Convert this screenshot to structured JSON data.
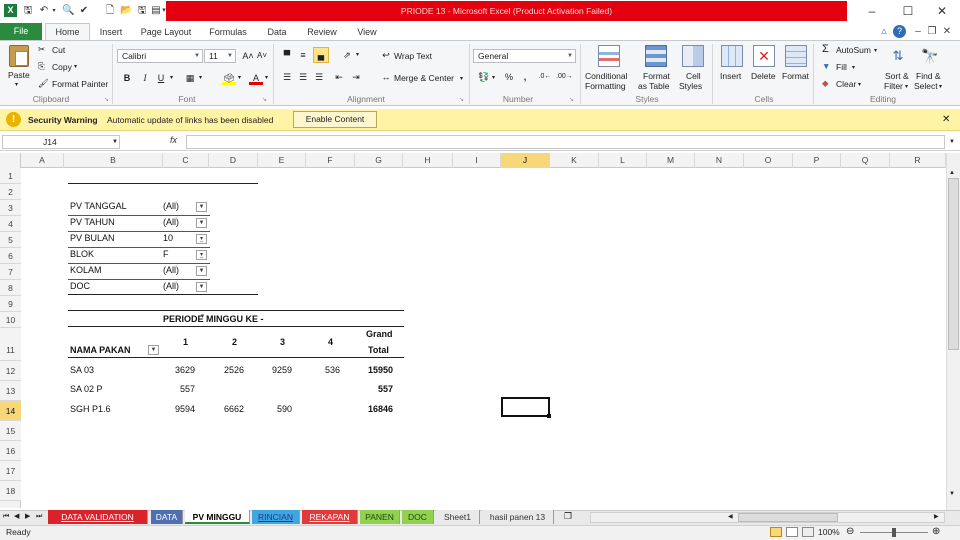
{
  "window": {
    "title": "PRIODE 13 -  Microsoft Excel (Product Activation Failed)"
  },
  "ribbon_tabs": [
    "File",
    "Home",
    "Insert",
    "Page Layout",
    "Formulas",
    "Data",
    "Review",
    "View"
  ],
  "ribbon": {
    "clipboard": {
      "paste": "Paste",
      "cut": "Cut",
      "copy": "Copy",
      "format_painter": "Format Painter",
      "group": "Clipboard"
    },
    "font": {
      "name": "Calibri",
      "size": "11",
      "bold": "B",
      "italic": "I",
      "underline": "U",
      "group": "Font"
    },
    "alignment": {
      "wrap_text": "Wrap Text",
      "merge_center": "Merge & Center",
      "group": "Alignment"
    },
    "number": {
      "format": "General",
      "percent": "%",
      "comma": ",",
      "group": "Number"
    },
    "styles": {
      "conditional": "Conditional",
      "conditional2": "Formatting",
      "format_as": "Format",
      "format_as2": "as Table",
      "cell_styles": "Cell",
      "cell_styles2": "Styles",
      "group": "Styles"
    },
    "cells": {
      "insert": "Insert",
      "delete": "Delete",
      "format": "Format",
      "group": "Cells"
    },
    "editing": {
      "autosum": "AutoSum",
      "fill": "Fill",
      "clear": "Clear",
      "sort": "Sort &",
      "sort2": "Filter",
      "find": "Find &",
      "find2": "Select",
      "group": "Editing"
    }
  },
  "security": {
    "label": "Security Warning",
    "message": "Automatic update of links has been disabled",
    "button": "Enable Content"
  },
  "formula_bar": {
    "name_box": "J14",
    "fx": "fx",
    "value": ""
  },
  "columns": [
    "A",
    "B",
    "C",
    "D",
    "E",
    "F",
    "G",
    "H",
    "I",
    "J",
    "K",
    "L",
    "M",
    "N",
    "O",
    "P",
    "Q",
    "R"
  ],
  "rows": [
    "1",
    "2",
    "3",
    "4",
    "5",
    "6",
    "7",
    "8",
    "9",
    "10",
    "11",
    "12",
    "13",
    "14",
    "15",
    "16",
    "17",
    "18"
  ],
  "pivot_filters": [
    {
      "label": "PV TANGGAL",
      "value": "(All)",
      "filtered": false
    },
    {
      "label": "PV TAHUN",
      "value": "(All)",
      "filtered": false
    },
    {
      "label": "PV BULAN",
      "value": "10",
      "filtered": true
    },
    {
      "label": "BLOK",
      "value": "F",
      "filtered": true
    },
    {
      "label": "KOLAM",
      "value": "(All)",
      "filtered": false
    },
    {
      "label": "DOC",
      "value": "(All)",
      "filtered": false
    }
  ],
  "pivot": {
    "column_field": "PERIODE MINGGU KE -",
    "row_field": "NAMA PAKAN",
    "headers": [
      "1",
      "2",
      "3",
      "4"
    ],
    "grand_total_1": "Grand",
    "grand_total_2": "Total",
    "rows": [
      {
        "name": "SA 03",
        "values": [
          "3629",
          "2526",
          "9259",
          "536"
        ],
        "total": "15950"
      },
      {
        "name": "SA 02 P",
        "values": [
          "557",
          "",
          "",
          ""
        ],
        "total": "557"
      },
      {
        "name": "SGH P1.6",
        "values": [
          "9594",
          "6662",
          "590",
          ""
        ],
        "total": "16846"
      }
    ]
  },
  "sheet_tabs": [
    {
      "name": "DATA VALIDATION",
      "color": "#d9222a",
      "text": "#ffffff"
    },
    {
      "name": "DATA",
      "color": "#4f6fb0",
      "text": "#ffffff"
    },
    {
      "name": "PV MINGGU",
      "color": "#ffffff",
      "text": "#000000"
    },
    {
      "name": "RINCIAN",
      "color": "#3fa7e0",
      "text": "#1a3a8a"
    },
    {
      "name": "REKAPAN",
      "color": "#e23a3a",
      "text": "#ffffff"
    },
    {
      "name": "PANEN",
      "color": "#92d050",
      "text": "#1a4a10"
    },
    {
      "name": "DOC",
      "color": "#92d050",
      "text": "#1a4a10"
    },
    {
      "name": "Sheet1",
      "color": "#e9e9e9",
      "text": "#333333"
    },
    {
      "name": "hasil panen 13",
      "color": "#e9e9e9",
      "text": "#333333"
    }
  ],
  "status": {
    "ready": "Ready",
    "zoom": "100%"
  }
}
